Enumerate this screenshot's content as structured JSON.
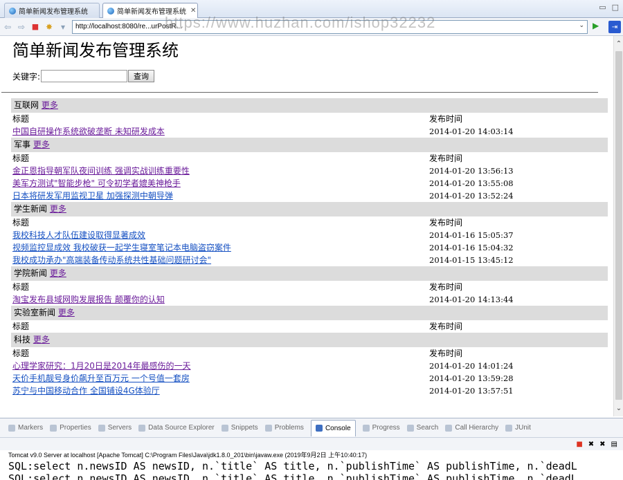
{
  "editor_tabs": [
    {
      "label": "简单新闻发布管理系统",
      "active": false
    },
    {
      "label": "简单新闻发布管理系统",
      "active": true
    }
  ],
  "browser": {
    "url": "http://localhost:8080/re...urPostR...",
    "watermark": "https://www.huzhan.com/ishop32232"
  },
  "page": {
    "title": "简单新闻发布管理系统",
    "search_label": "关键字:",
    "search_value": "",
    "search_button": "查询",
    "title_header": "标题",
    "time_header": "发布时间",
    "more_label": "更多",
    "categories": [
      {
        "name": "互联网",
        "items": [
          {
            "title": "中国自研操作系统欲破垄断 未知研发成本",
            "time": "2014-01-20 14:03:14",
            "visited": true
          }
        ]
      },
      {
        "name": "军事",
        "items": [
          {
            "title": "金正恩指导朝军队夜间训练 强调实战训练重要性",
            "time": "2014-01-20 13:56:13",
            "visited": true
          },
          {
            "title": "美军方测试\"智能步枪\" 可令初学者媲美神枪手",
            "time": "2014-01-20 13:55:08",
            "visited": true
          },
          {
            "title": "日本将研发军用监视卫星 加强探测中朝导弹",
            "time": "2014-01-20 13:52:24",
            "visited": false
          }
        ]
      },
      {
        "name": "学生新闻",
        "items": [
          {
            "title": "我校科技人才队伍建设取得显著成效",
            "time": "2014-01-16 15:05:37",
            "visited": false
          },
          {
            "title": "视频监控显成效 我校破获一起学生寝室笔记本电脑盗窃案件",
            "time": "2014-01-16 15:04:32",
            "visited": false
          },
          {
            "title": "我校成功承办\"高端装备传动系统共性基础问题研讨会\"",
            "time": "2014-01-15 13:45:12",
            "visited": false
          }
        ]
      },
      {
        "name": "学院新闻",
        "items": [
          {
            "title": "淘宝发布县域网购发展报告 颠覆你的认知",
            "time": "2014-01-20 14:13:44",
            "visited": true
          }
        ]
      },
      {
        "name": "实验室新闻",
        "items": []
      },
      {
        "name": "科技",
        "items": [
          {
            "title": "心理学家研究：1月20日是2014年最感伤的一天",
            "time": "2014-01-20 14:01:24",
            "visited": true
          },
          {
            "title": "天价手机靓号身价飙升至百万元 一个号值一套房",
            "time": "2014-01-20 13:59:28",
            "visited": false
          },
          {
            "title": "苏宁与中国移动合作 全国铺设4G体验厅",
            "time": "2014-01-20 13:57:51",
            "visited": false
          }
        ]
      }
    ]
  },
  "panel": {
    "tabs": [
      "Markers",
      "Properties",
      "Servers",
      "Data Source Explorer",
      "Snippets",
      "Problems",
      "Console",
      "Progress",
      "Search",
      "Call Hierarchy",
      "JUnit"
    ],
    "active_tab": "Console",
    "console_title": "Tomcat v9.0 Server at localhost [Apache Tomcat] C:\\Program Files\\Java\\jdk1.8.0_201\\bin\\javaw.exe (2019年9月2日 上午10:40:17)",
    "lines": [
      "SQL:select n.newsID AS newsID, n.`title` AS title, n.`publishTime` AS publishTime, n.`deadL",
      "SQL:select n.newsID AS newsID, n.`title` AS title, n.`publishTime` AS publishTime, n.`deadL"
    ]
  }
}
